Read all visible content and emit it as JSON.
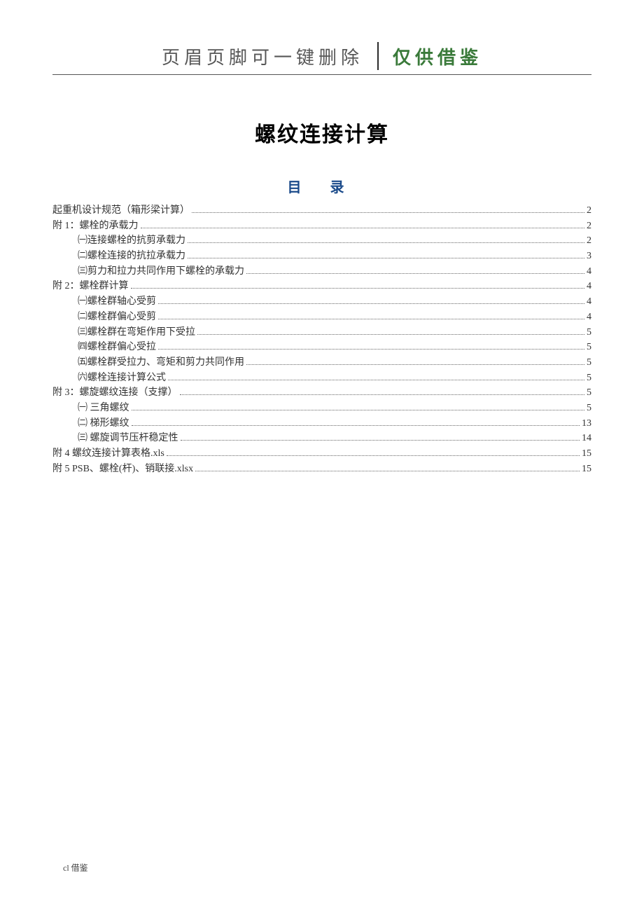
{
  "header": {
    "left": "页眉页脚可一键删除",
    "right": "仅供借鉴"
  },
  "title": "螺纹连接计算",
  "toc_heading": "目  录",
  "toc": [
    {
      "label": "起重机设计规范（箱形梁计算）",
      "page": "2",
      "indent": 0
    },
    {
      "label": "附 1：螺栓的承载力",
      "page": "2",
      "indent": 0
    },
    {
      "label": "㈠连接螺栓的抗剪承载力",
      "page": "2",
      "indent": 1
    },
    {
      "label": "㈡螺栓连接的抗拉承载力",
      "page": "3",
      "indent": 1
    },
    {
      "label": "㈢剪力和拉力共同作用下螺栓的承载力",
      "page": "4",
      "indent": 1
    },
    {
      "label": "附 2：螺栓群计算",
      "page": "4",
      "indent": 0
    },
    {
      "label": "㈠螺栓群轴心受剪",
      "page": "4",
      "indent": 1
    },
    {
      "label": "㈡螺栓群偏心受剪",
      "page": "4",
      "indent": 1
    },
    {
      "label": "㈢螺栓群在弯矩作用下受拉",
      "page": "5",
      "indent": 1
    },
    {
      "label": "㈣螺栓群偏心受拉",
      "page": "5",
      "indent": 1
    },
    {
      "label": "㈤螺栓群受拉力、弯矩和剪力共同作用",
      "page": "5",
      "indent": 1
    },
    {
      "label": "㈥螺栓连接计算公式",
      "page": "5",
      "indent": 1
    },
    {
      "label": "附 3：螺旋螺纹连接（支撑）",
      "page": "5",
      "indent": 0
    },
    {
      "label": "㈠ 三角螺纹",
      "page": "5",
      "indent": 1
    },
    {
      "label": "㈡ 梯形螺纹",
      "page": "13",
      "indent": 1
    },
    {
      "label": "㈢ 螺旋调节压杆稳定性",
      "page": "14",
      "indent": 1
    },
    {
      "label": "附 4 螺纹连接计算表格.xls",
      "page": "15",
      "indent": 0
    },
    {
      "label": "附 5 PSB、螺栓(杆)、销联接.xlsx",
      "page": "15",
      "indent": 0
    }
  ],
  "footer": "cl 借鉴"
}
